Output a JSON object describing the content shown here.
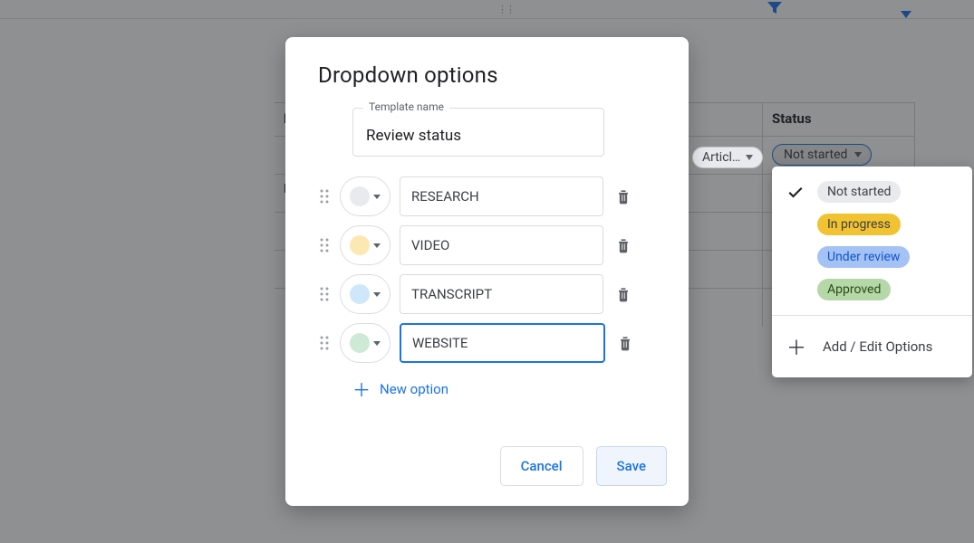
{
  "dialog": {
    "title": "Dropdown options",
    "template_label": "Template name",
    "template_value": "Review status",
    "options": [
      {
        "label": "RESEARCH",
        "color": "gray"
      },
      {
        "label": "VIDEO",
        "color": "yellow"
      },
      {
        "label": "TRANSCRIPT",
        "color": "blue"
      },
      {
        "label": "WEBSITE",
        "color": "green",
        "focused": true
      }
    ],
    "new_option_label": "New option",
    "cancel_label": "Cancel",
    "save_label": "Save"
  },
  "bg": {
    "status_header": "Status",
    "selected_chip": "Not started",
    "article_chip": "Articl…"
  },
  "status_menu": {
    "items": [
      {
        "label": "Not started",
        "pill": "gray",
        "checked": true
      },
      {
        "label": "In progress",
        "pill": "yellow",
        "checked": false
      },
      {
        "label": "Under review",
        "pill": "blue",
        "checked": false
      },
      {
        "label": "Approved",
        "pill": "green",
        "checked": false
      }
    ],
    "edit_label": "Add / Edit Options"
  }
}
